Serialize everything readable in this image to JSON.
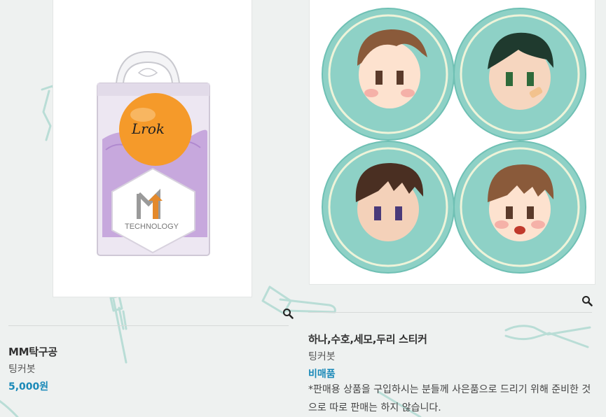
{
  "products": [
    {
      "name": "MM탁구공",
      "brand": "팅커봇",
      "price": "5,000원",
      "image_logo_text": "TECHNOLOGY",
      "image_signature": "Lrok",
      "zoom_icon": "magnifier-icon"
    },
    {
      "name": "하나,수호,세모,두리 스티커",
      "brand": "팅커봇",
      "price": "비매품",
      "note": "*판매용 상품을 구입하시는 분들께 사은품으로 드리기 위해 준비한 것으로 따로 판매는 하지 않습니다.",
      "zoom_icon": "magnifier-icon"
    }
  ],
  "colors": {
    "background": "#eef1f0",
    "accent_price": "#1a89b8",
    "sticker_teal": "#8ed1c6",
    "tool_pattern": "#b9ddd6"
  }
}
